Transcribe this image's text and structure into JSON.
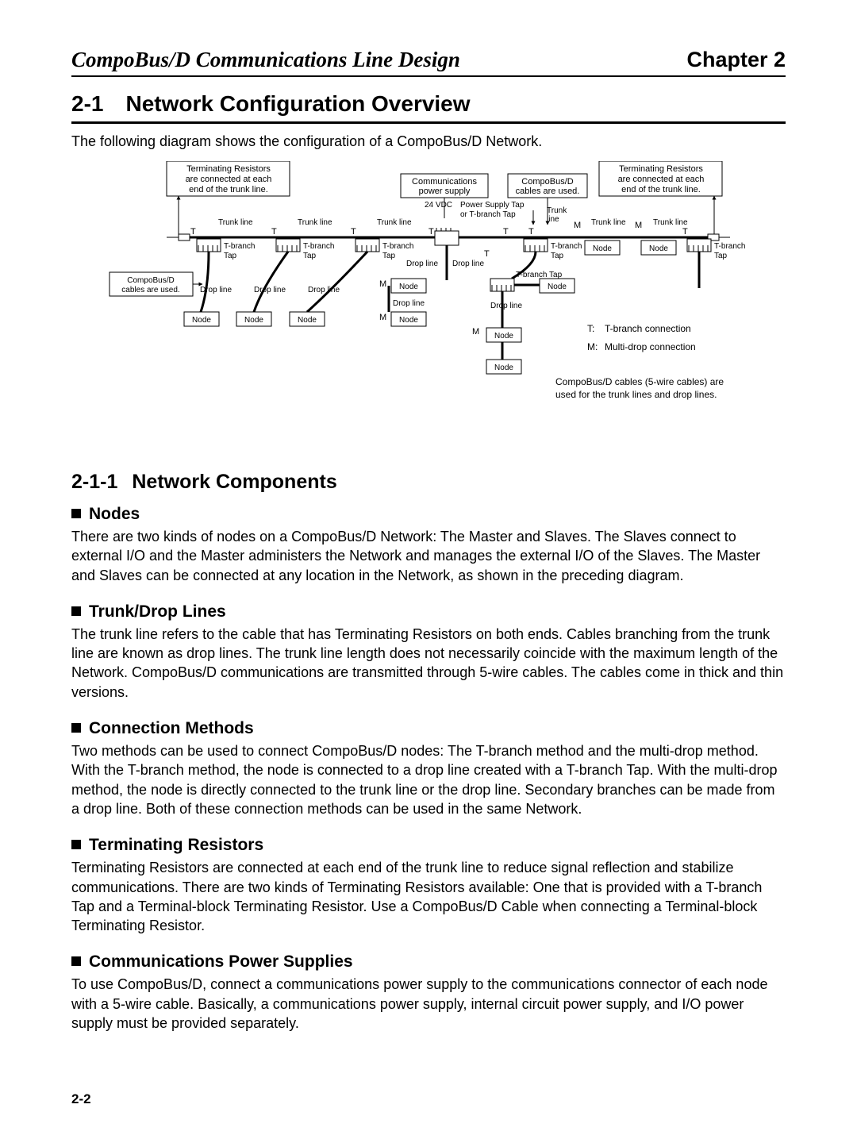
{
  "header": {
    "left": "CompoBus/D Communications Line Design",
    "right": "Chapter 2"
  },
  "section": {
    "number": "2-1",
    "title": "Network Configuration Overview",
    "intro": "The following diagram shows the configuration of a CompoBus/D Network."
  },
  "diagram": {
    "note_term_left": [
      "Terminating Resistors",
      "are connected at each",
      "end of the trunk line."
    ],
    "note_term_right": [
      "Terminating Resistors",
      "are connected at each",
      "end of the trunk line."
    ],
    "comm_ps": [
      "Communications",
      "power supply"
    ],
    "cables_used_top": [
      "CompoBus/D",
      "cables are used."
    ],
    "v24": "24 VDC",
    "ps_tap": [
      "Power Supply Tap",
      "or T-branch Tap"
    ],
    "trunk_line": "Trunk line",
    "trunk_short": "Trunk",
    "line_short": "line",
    "tbranch_tap": [
      "T-branch",
      "Tap"
    ],
    "drop_line": "Drop line",
    "node": "Node",
    "cables_used_left": [
      "CompoBus/D",
      "cables are used."
    ],
    "tbranch_tap_single": "T-branch Tap",
    "legend_T": "T:",
    "legend_T_val": "T-branch connection",
    "legend_M": "M:",
    "legend_M_val": "Multi-drop connection",
    "cable_note": [
      "CompoBus/D cables (5-wire cables) are",
      "used for the trunk lines and drop lines."
    ],
    "T": "T",
    "M": "M"
  },
  "subsection": {
    "number": "2-1-1",
    "title": "Network Components"
  },
  "topics": [
    {
      "title": "Nodes",
      "body": "There are two kinds of nodes on a CompoBus/D Network: The Master and Slaves. The Slaves connect to external I/O and the Master administers the Network and manages the external I/O of the Slaves. The Master and Slaves can be connected at any location in the Network, as shown in the preceding diagram."
    },
    {
      "title": "Trunk/Drop Lines",
      "body": "The trunk line refers to the cable that has Terminating Resistors on both ends. Cables branching from the trunk line are known as drop lines. The trunk line length does not necessarily coincide with the maximum length of the Network. CompoBus/D communications are transmitted through 5-wire cables. The cables come in thick and thin versions."
    },
    {
      "title": "Connection Methods",
      "body": "Two methods can be used to connect CompoBus/D nodes: The T-branch method and the multi-drop method. With the T-branch method, the node is connected to a drop line created with a T-branch Tap. With the multi-drop method, the node is directly connected to the trunk line or the drop line. Secondary branches can be made from a drop line. Both of these connection methods can be used in the same Network."
    },
    {
      "title": "Terminating Resistors",
      "body": "Terminating Resistors are connected at each end of the trunk line to reduce signal reflection and stabilize communications. There are two kinds of Terminating Resistors available: One that is provided with a T-branch Tap and a Terminal-block Terminating Resistor. Use a CompoBus/D Cable when connecting a Terminal-block Terminating Resistor."
    },
    {
      "title": "Communications Power Supplies",
      "body": "To use CompoBus/D, connect a communications power supply to the communications connector of each node with a 5-wire cable. Basically, a communications power supply, internal circuit power supply, and I/O power supply must be provided separately."
    }
  ],
  "page_number": "2-2"
}
